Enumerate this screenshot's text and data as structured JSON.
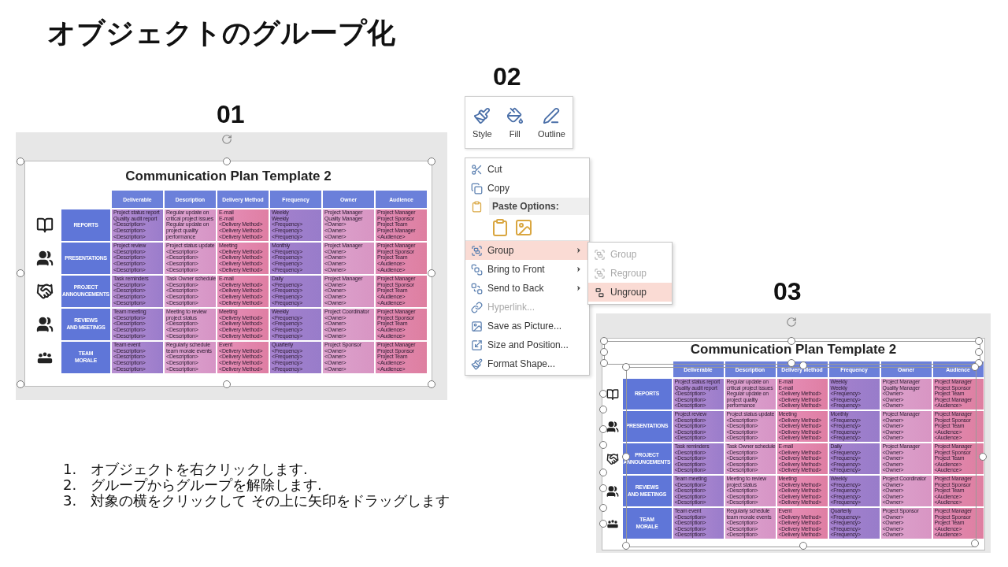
{
  "title": "オブジェクトのグループ化",
  "step_01": {
    "label": "01",
    "slide": {
      "title": "Communication Plan Template 2",
      "table": {
        "columns": [
          "Deliverable",
          "Description",
          "Delivery Method",
          "Frequency",
          "Owner",
          "Audience"
        ],
        "rows": [
          {
            "label": "REPORTS",
            "cells": [
              "Project status report\nQuality audit report\n<Description>\n<Description>\n<Description>",
              "Regular update on\ncritical project issues\nRegular update on\nproject quality\nperformance",
              "E-mail\nE-mail\n<Delivery Method>\n<Delivery Method>\n<Delivery Method>",
              "Weekly\nWeekly\n<Frequency>\n<Frequency>\n<Frequency>",
              "Project Manager\nQuality Manager\n<Owner>\n<Owner>\n<Owner>",
              "Project Manager\nProject Sponsor\nProject Team\nProject Manager\n<Audience>"
            ]
          },
          {
            "label": "PRESENTATIONS",
            "cells": [
              "Project review\n<Description>\n<Description>\n<Description>\n<Description>",
              "Project status update\n<Description>\n<Description>\n<Description>\n<Description>",
              "Meeting\n<Delivery Method>\n<Delivery Method>\n<Delivery Method>\n<Delivery Method>",
              "Monthly\n<Frequency>\n<Frequency>\n<Frequency>\n<Frequency>",
              "Project Manager\n<Owner>\n<Owner>\n<Owner>\n<Owner>",
              "Project Manager\nProject Sponsor\nProject Team\n<Audience>\n<Audience>"
            ]
          },
          {
            "label": "PROJECT\nANNOUNCEMENTS",
            "cells": [
              "Task reminders\n<Description>\n<Description>\n<Description>\n<Description>",
              "Task Owner schedule\n<Description>\n<Description>\n<Description>\n<Description>",
              "E-mail\n<Delivery Method>\n<Delivery Method>\n<Delivery Method>\n<Delivery Method>",
              "Daily\n<Frequency>\n<Frequency>\n<Frequency>\n<Frequency>",
              "Project Manager\n<Owner>\n<Owner>\n<Owner>\n<Owner>",
              "Project Manager\nProject Sponsor\nProject Team\n<Audience>\n<Audience>"
            ]
          },
          {
            "label": "REVIEWS\nAND MEETINGS",
            "cells": [
              "Team meeting\n<Description>\n<Description>\n<Description>\n<Description>",
              "Meeting to review\nproject status\n<Description>\n<Description>\n<Description>",
              "Meeting\n<Delivery Method>\n<Delivery Method>\n<Delivery Method>\n<Delivery Method>",
              "Weekly\n<Frequency>\n<Frequency>\n<Frequency>\n<Frequency>",
              "Project Coordinator\n<Owner>\n<Owner>\n<Owner>\n<Owner>",
              "Project Manager\nProject Sponsor\nProject Team\n<Audience>\n<Audience>"
            ]
          },
          {
            "label": "TEAM\nMORALE",
            "cells": [
              "Team event\n<Description>\n<Description>\n<Description>\n<Description>",
              "Regularly schedule\nteam morale events\n<Description>\n<Description>\n<Description>",
              "Event\n<Delivery Method>\n<Delivery Method>\n<Delivery Method>\n<Delivery Method>",
              "Quarterly\n<Frequency>\n<Frequency>\n<Frequency>\n<Frequency>",
              "Project Sponsor\n<Owner>\n<Owner>\n<Owner>\n<Owner>",
              "Project Manager\nProject Sponsor\nProject Team\n<Audience>\n<Audience>"
            ]
          }
        ]
      }
    }
  },
  "step_02": {
    "label": "02",
    "ribbon": [
      "Style",
      "Fill",
      "Outline"
    ],
    "menu": [
      {
        "kind": "item",
        "label": "Cut",
        "selected": false,
        "disabled": false,
        "submenu": false
      },
      {
        "kind": "item",
        "label": "Copy",
        "selected": false,
        "disabled": false,
        "submenu": false
      },
      {
        "kind": "header",
        "label": "Paste Options:"
      },
      {
        "kind": "paste-icons"
      },
      {
        "kind": "item",
        "label": "Group",
        "selected": true,
        "disabled": false,
        "submenu": true
      },
      {
        "kind": "item",
        "label": "Bring to Front",
        "selected": false,
        "disabled": false,
        "submenu": true
      },
      {
        "kind": "item",
        "label": "Send to Back",
        "selected": false,
        "disabled": false,
        "submenu": true
      },
      {
        "kind": "item",
        "label": "Hyperlink...",
        "selected": false,
        "disabled": true,
        "submenu": false
      },
      {
        "kind": "item",
        "label": "Save as Picture...",
        "selected": false,
        "disabled": false,
        "submenu": false
      },
      {
        "kind": "item",
        "label": "Size and Position...",
        "selected": false,
        "disabled": false,
        "submenu": false
      },
      {
        "kind": "item",
        "label": "Format Shape...",
        "selected": false,
        "disabled": false,
        "submenu": false
      }
    ],
    "submenu": [
      {
        "label": "Group",
        "selected": false,
        "disabled": true
      },
      {
        "label": "Regroup",
        "selected": false,
        "disabled": true
      },
      {
        "label": "Ungroup",
        "selected": true,
        "disabled": false
      }
    ]
  },
  "step_03": {
    "label": "03",
    "slide": {
      "title": "Communication Plan Template 2",
      "table": {
        "columns": [
          "Deliverable",
          "Description",
          "Delivery Method",
          "Frequency",
          "Owner",
          "Audience"
        ],
        "rows": [
          {
            "label": "REPORTS",
            "cells": [
              "Project status report\nQuality audit report\n<Description>\n<Description>\n<Description>",
              "Regular update on\ncritical project issues\nRegular update on\nproject quality\nperformance",
              "E-mail\nE-mail\n<Delivery Method>\n<Delivery Method>\n<Delivery Method>",
              "Weekly\nWeekly\n<Frequency>\n<Frequency>\n<Frequency>",
              "Project Manager\nQuality Manager\n<Owner>\n<Owner>\n<Owner>",
              "Project Manager\nProject Sponsor\nProject Team\nProject Manager\n<Audience>"
            ]
          },
          {
            "label": "PRESENTATIONS",
            "cells": [
              "Project review\n<Description>\n<Description>\n<Description>\n<Description>",
              "Project status update\n<Description>\n<Description>\n<Description>\n<Description>",
              "Meeting\n<Delivery Method>\n<Delivery Method>\n<Delivery Method>\n<Delivery Method>",
              "Monthly\n<Frequency>\n<Frequency>\n<Frequency>\n<Frequency>",
              "Project Manager\n<Owner>\n<Owner>\n<Owner>\n<Owner>",
              "Project Manager\nProject Sponsor\nProject Team\n<Audience>\n<Audience>"
            ]
          },
          {
            "label": "PROJECT\nANNOUNCEMENTS",
            "cells": [
              "Task reminders\n<Description>\n<Description>\n<Description>\n<Description>",
              "Task Owner schedule\n<Description>\n<Description>\n<Description>\n<Description>",
              "E-mail\n<Delivery Method>\n<Delivery Method>\n<Delivery Method>\n<Delivery Method>",
              "Daily\n<Frequency>\n<Frequency>\n<Frequency>\n<Frequency>",
              "Project Manager\n<Owner>\n<Owner>\n<Owner>\n<Owner>",
              "Project Manager\nProject Sponsor\nProject Team\n<Audience>\n<Audience>"
            ]
          },
          {
            "label": "REVIEWS\nAND MEETINGS",
            "cells": [
              "Team meeting\n<Description>\n<Description>\n<Description>\n<Description>",
              "Meeting to review\nproject status\n<Description>\n<Description>\n<Description>",
              "Meeting\n<Delivery Method>\n<Delivery Method>\n<Delivery Method>\n<Delivery Method>",
              "Weekly\n<Frequency>\n<Frequency>\n<Frequency>\n<Frequency>",
              "Project Coordinator\n<Owner>\n<Owner>\n<Owner>\n<Owner>",
              "Project Manager\nProject Sponsor\nProject Team\n<Audience>\n<Audience>"
            ]
          },
          {
            "label": "TEAM\nMORALE",
            "cells": [
              "Team event\n<Description>\n<Description>\n<Description>\n<Description>",
              "Regularly schedule\nteam morale events\n<Description>\n<Description>\n<Description>",
              "Event\n<Delivery Method>\n<Delivery Method>\n<Delivery Method>\n<Delivery Method>",
              "Quarterly\n<Frequency>\n<Frequency>\n<Frequency>\n<Frequency>",
              "Project Sponsor\n<Owner>\n<Owner>\n<Owner>\n<Owner>",
              "Project Manager\nProject Sponsor\nProject Team\n<Audience>\n<Audience>"
            ]
          }
        ]
      }
    }
  },
  "steps": [
    {
      "number": "1.",
      "text": "オブジェクトを右クリックします."
    },
    {
      "number": "2.",
      "text": "グループからグループを解除します."
    },
    {
      "number": "3.",
      "text": "対象の横をクリックして その上に矢印をドラッグします"
    }
  ]
}
